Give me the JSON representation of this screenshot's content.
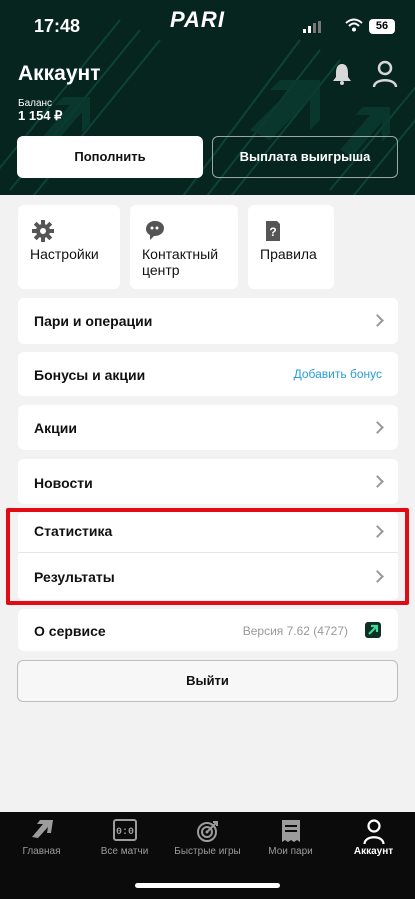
{
  "status_bar": {
    "time": "17:48",
    "battery": "56"
  },
  "brand": {
    "logo": "PARI"
  },
  "header": {
    "title": "Аккаунт",
    "balance_label": "Баланс",
    "balance_value": "1 154 ₽",
    "deposit_label": "Пополнить",
    "withdraw_label": "Выплата выигрыша",
    "icons": [
      "bell-icon",
      "user-icon"
    ]
  },
  "tiles": [
    {
      "label": "Настройки",
      "icon": "gear-icon"
    },
    {
      "label": "Контактный центр",
      "icon": "support-chat-icon"
    },
    {
      "label": "Правила",
      "icon": "rules-document-icon"
    }
  ],
  "menu": {
    "bets": {
      "label": "Пари и операции"
    },
    "bonuses": {
      "label": "Бонусы и акции",
      "link": "Добавить бонус"
    },
    "promos": {
      "label": "Акции"
    },
    "news": {
      "label": "Новости"
    },
    "stats": {
      "label": "Статистика"
    },
    "results": {
      "label": "Результаты"
    },
    "about": {
      "label": "О сервисе",
      "version": "Версия 7.62 (4727)"
    }
  },
  "logout_label": "Выйти",
  "tabbar": {
    "items": [
      {
        "label": "Главная",
        "icon": "home-arrow-icon"
      },
      {
        "label": "Все матчи",
        "icon": "scoreboard-icon"
      },
      {
        "label": "Быстрые игры",
        "icon": "target-icon"
      },
      {
        "label": "Мои пари",
        "icon": "receipt-icon"
      },
      {
        "label": "Аккаунт",
        "icon": "user-icon"
      }
    ],
    "active": "Аккаунт"
  },
  "colors": {
    "header_bg": "#06251f",
    "highlight_border": "#e30b13",
    "link": "#2a9fd6"
  }
}
